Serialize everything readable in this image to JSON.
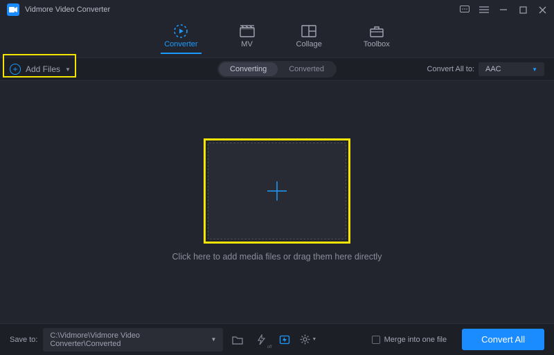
{
  "app": {
    "title": "Vidmore Video Converter"
  },
  "tabs": [
    {
      "label": "Converter",
      "active": true
    },
    {
      "label": "MV",
      "active": false
    },
    {
      "label": "Collage",
      "active": false
    },
    {
      "label": "Toolbox",
      "active": false
    }
  ],
  "subbar": {
    "add_files_label": "Add Files",
    "subtabs": {
      "converting": "Converting",
      "converted": "Converted"
    },
    "convert_all_label": "Convert All to:",
    "format_selected": "AAC"
  },
  "main": {
    "hint": "Click here to add media files or drag them here directly"
  },
  "footer": {
    "saveto_label": "Save to:",
    "path": "C:\\Vidmore\\Vidmore Video Converter\\Converted",
    "merge_label": "Merge into one file",
    "convert_button": "Convert All"
  },
  "icons": {
    "gpu_sub": "off"
  }
}
